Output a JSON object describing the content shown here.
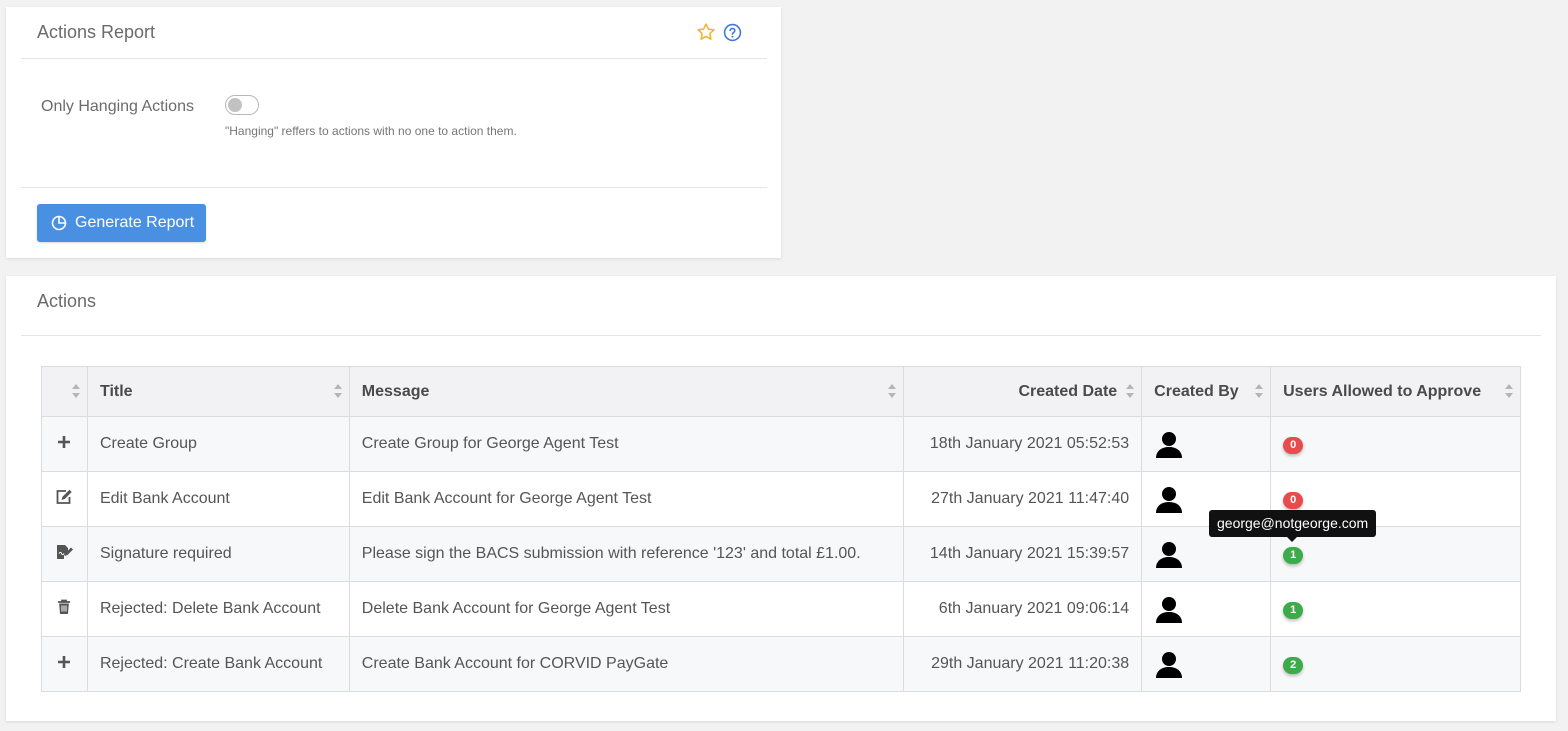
{
  "report": {
    "title": "Actions Report",
    "icons": {
      "favourite": "star-icon",
      "help": "question-circle-icon"
    },
    "filter_label": "Only Hanging Actions",
    "filter_toggle_on": false,
    "filter_help": "\"Hanging\" reffers to actions with no one to action them.",
    "generate_button": "Generate Report"
  },
  "actions": {
    "title": "Actions",
    "columns": [
      "",
      "Title",
      "Message",
      "Created Date",
      "Created By",
      "Users Allowed to Approve"
    ],
    "rows": [
      {
        "icon": "plus-icon",
        "title": "Create Group",
        "message": "Create Group for George Agent Test",
        "created_date": "18th January 2021 05:52:53",
        "created_by_icon": "user-avatar-icon",
        "approvers": "0",
        "approvers_color": "#e74c4c"
      },
      {
        "icon": "edit-icon",
        "title": "Edit Bank Account",
        "message": "Edit Bank Account for George Agent Test",
        "created_date": "27th January 2021 11:47:40",
        "created_by_icon": "user-avatar-icon",
        "approvers": "0",
        "approvers_color": "#e74c4c"
      },
      {
        "icon": "signature-icon",
        "title": "Signature required",
        "message": "Please sign the BACS submission with reference '123' and total £1.00.",
        "created_date": "14th January 2021 15:39:57",
        "created_by_icon": "user-avatar-icon",
        "approvers": "1",
        "approvers_color": "#3cab4a"
      },
      {
        "icon": "trash-icon",
        "title": "Rejected: Delete Bank Account",
        "message": "Delete Bank Account for George Agent Test",
        "created_date": "6th January 2021 09:06:14",
        "created_by_icon": "user-avatar-icon",
        "approvers": "1",
        "approvers_color": "#3cab4a"
      },
      {
        "icon": "plus-icon",
        "title": "Rejected: Create Bank Account",
        "message": "Create Bank Account for CORVID PayGate",
        "created_date": "29th January 2021 11:20:38",
        "created_by_icon": "user-avatar-icon",
        "approvers": "2",
        "approvers_color": "#3cab4a"
      }
    ]
  },
  "tooltip": {
    "text": "george@notgeorge.com"
  },
  "colors": {
    "primary": "#4a90e2",
    "danger": "#e74c4c",
    "success": "#3cab4a",
    "star": "#f0b429"
  }
}
